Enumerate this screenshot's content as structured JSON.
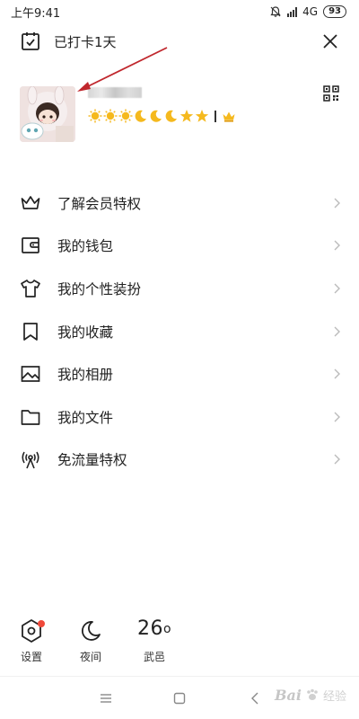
{
  "status_bar": {
    "time": "上午9:41",
    "network": "4G",
    "hd_label": "HD",
    "battery": "93",
    "icons": [
      "bell-mute-icon",
      "signal-icon",
      "battery-icon"
    ]
  },
  "header": {
    "checkin_label": "已打卡1天",
    "checkin_icon": "calendar-check-icon",
    "close_icon": "close-icon"
  },
  "profile": {
    "badges": [
      "sun",
      "sun",
      "sun",
      "moon",
      "moon",
      "moon",
      "star",
      "star",
      "crown"
    ],
    "qr_icon": "qr-code-icon"
  },
  "menu": {
    "items": [
      {
        "label": "了解会员特权",
        "icon": "crown-outline-icon"
      },
      {
        "label": "我的钱包",
        "icon": "wallet-icon"
      },
      {
        "label": "我的个性装扮",
        "icon": "tshirt-icon"
      },
      {
        "label": "我的收藏",
        "icon": "bookmark-icon"
      },
      {
        "label": "我的相册",
        "icon": "image-icon"
      },
      {
        "label": "我的文件",
        "icon": "folder-icon"
      },
      {
        "label": "免流量特权",
        "icon": "antenna-icon"
      }
    ]
  },
  "bottom": {
    "settings_label": "设置",
    "night_label": "夜间",
    "weather_temp": "26",
    "weather_unit": "o",
    "weather_city": "武邑"
  },
  "watermark": {
    "text": "Bai",
    "sub": "经验"
  },
  "colors": {
    "accent_red": "#f0493a",
    "annotation_arrow": "#c0272d",
    "badge_gold": "#f5b91e"
  }
}
